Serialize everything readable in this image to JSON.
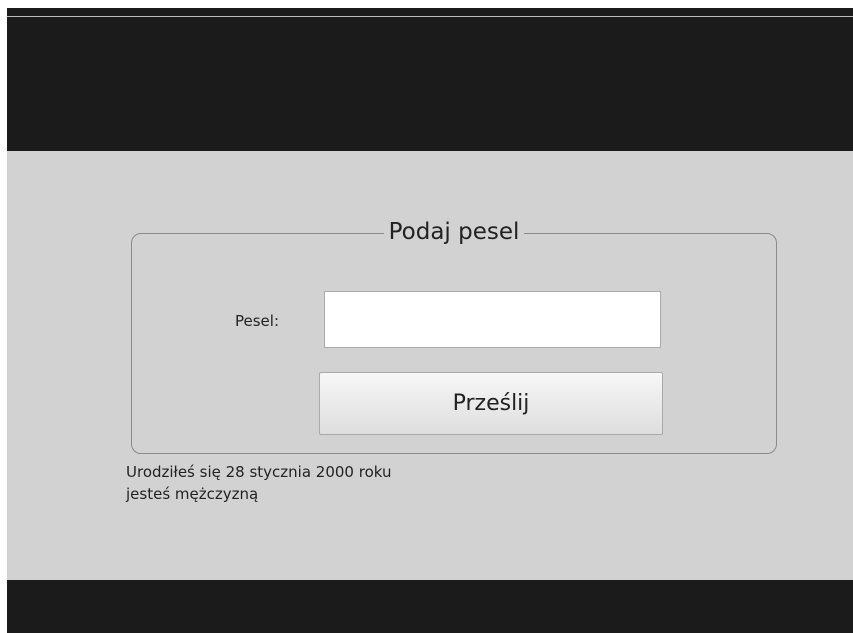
{
  "form": {
    "legend": "Podaj pesel",
    "pesel_label": "Pesel:",
    "pesel_value": "",
    "submit_label": "Prześlij"
  },
  "result": {
    "line1": "Urodziłeś się 28 stycznia 2000 roku",
    "line2": "jesteś mężczyzną"
  }
}
